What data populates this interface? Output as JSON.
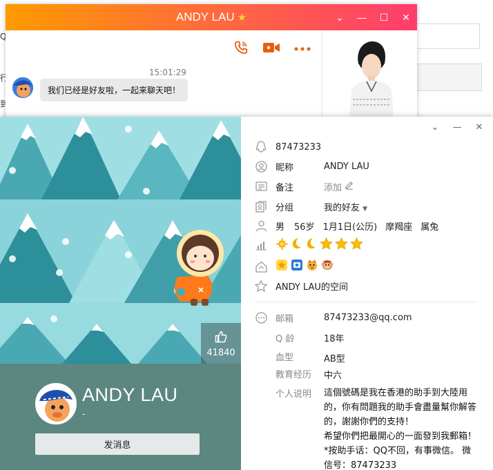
{
  "background": {
    "frag_left": "QQ",
    "frag_left2": "行",
    "frag_left3": "到"
  },
  "chat": {
    "title": "ANDY LAU",
    "time": "15:01:29",
    "message": "我们已经是好友啦，一起来聊天吧！",
    "icons": [
      "phone-icon",
      "video-call-icon",
      "more-icon"
    ]
  },
  "card": {
    "likes": "41840",
    "name": "ANDY LAU",
    "signature": "-",
    "send_button": "发消息",
    "qq_number": "87473233",
    "nickname_label": "昵称",
    "nickname": "ANDY LAU",
    "remark_label": "备注",
    "remark_value": "添加",
    "group_label": "分组",
    "group_value": "我的好友",
    "gender": "男",
    "age": "56岁",
    "birthday": "1月1日(公历)",
    "zodiac": "摩羯座",
    "chinese_zodiac": "属兔",
    "space": "ANDY LAU的空间",
    "email_label": "邮箱",
    "email": "87473233@qq.com",
    "qage_label": "Q 龄",
    "qage": "18年",
    "blood_label": "血型",
    "blood": "AB型",
    "edu_label": "教育经历",
    "edu": "中六",
    "intro_label": "个人说明",
    "intro": "這個號碼是我在香港的助手到大陸用的，你有問題我的助手會盡量幫你解答的，謝謝你們的支持！\n希望你們把最開心的一面發到我郵箱！\n*按助手话：QQ不回，有事微信。 微信号：87473233"
  },
  "colors": {
    "title_gradient_start": "#ff9a00",
    "title_gradient_end": "#ff3d6e",
    "accent_orange": "#e85d10",
    "banner_bg": "#8fd6dd",
    "profile_bar": "#5b8780"
  }
}
